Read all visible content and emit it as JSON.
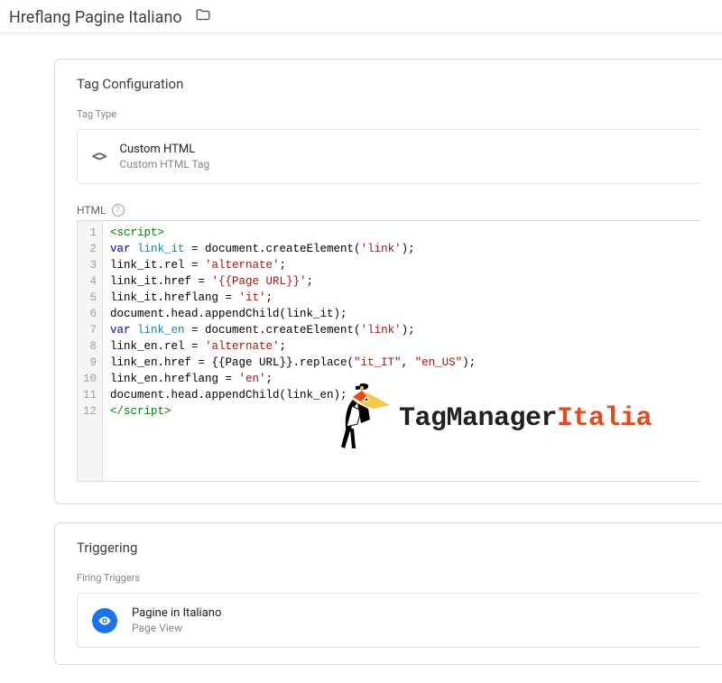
{
  "header": {
    "title": "Hreflang Pagine Italiano"
  },
  "tagConfig": {
    "cardTitle": "Tag Configuration",
    "typeLabel": "Tag Type",
    "typeName": "Custom HTML",
    "typeSub": "Custom HTML Tag",
    "htmlLabel": "HTML",
    "code": [
      [
        [
          "t-tag",
          "<script>"
        ]
      ],
      [
        [
          "t-kw",
          "var "
        ],
        [
          "t-var",
          "link_it"
        ],
        [
          "t-plain",
          " = document.createElement("
        ],
        [
          "t-str",
          "'link'"
        ],
        [
          "t-plain",
          ");"
        ]
      ],
      [
        [
          "t-plain",
          "link_it.rel = "
        ],
        [
          "t-str",
          "'alternate'"
        ],
        [
          "t-plain",
          ";"
        ]
      ],
      [
        [
          "t-plain",
          "link_it.href = "
        ],
        [
          "t-str",
          "'{{Page URL}}'"
        ],
        [
          "t-plain",
          ";"
        ]
      ],
      [
        [
          "t-plain",
          "link_it.hreflang = "
        ],
        [
          "t-str",
          "'it'"
        ],
        [
          "t-plain",
          ";"
        ]
      ],
      [
        [
          "t-plain",
          "document.head.appendChild(link_it);"
        ]
      ],
      [
        [
          "t-kw",
          "var "
        ],
        [
          "t-var",
          "link_en"
        ],
        [
          "t-plain",
          " = document.createElement("
        ],
        [
          "t-str",
          "'link'"
        ],
        [
          "t-plain",
          ");"
        ]
      ],
      [
        [
          "t-plain",
          "link_en.rel = "
        ],
        [
          "t-str",
          "'alternate'"
        ],
        [
          "t-plain",
          ";"
        ]
      ],
      [
        [
          "t-plain",
          "link_en.href = {{Page URL}}.replace("
        ],
        [
          "t-str",
          "\"it_IT\""
        ],
        [
          "t-plain",
          ", "
        ],
        [
          "t-str",
          "\"en_US\""
        ],
        [
          "t-plain",
          ");"
        ]
      ],
      [
        [
          "t-plain",
          "link_en.hreflang = "
        ],
        [
          "t-str",
          "'en'"
        ],
        [
          "t-plain",
          ";"
        ]
      ],
      [
        [
          "t-plain",
          "document.head.appendChild(link_en);"
        ]
      ],
      [
        [
          "t-tag",
          "</script>"
        ]
      ]
    ]
  },
  "triggering": {
    "cardTitle": "Triggering",
    "label": "Firing Triggers",
    "name": "Pagine in Italiano",
    "sub": "Page View"
  },
  "logo": {
    "part1": "TagManager",
    "part2": "Italia"
  }
}
